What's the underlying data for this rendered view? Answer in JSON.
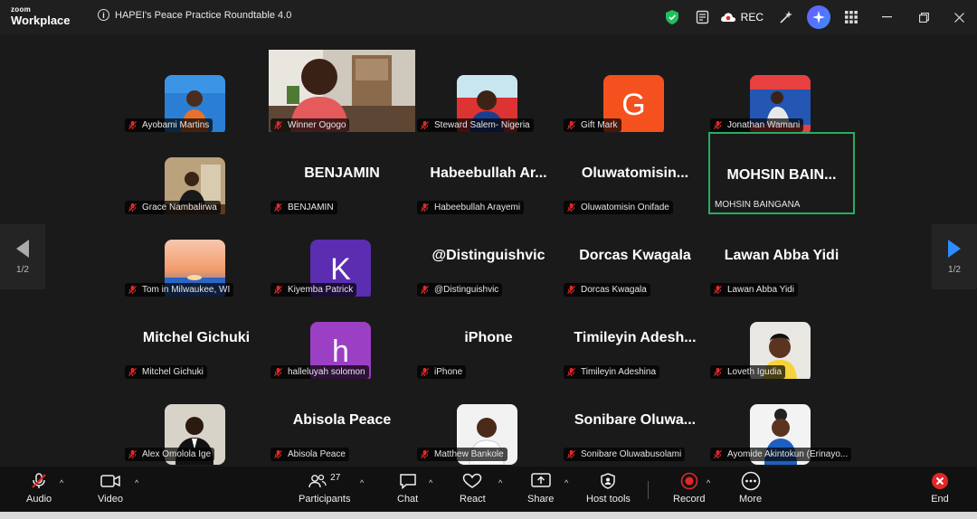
{
  "app": {
    "brand_small": "zoom",
    "brand_big": "Workplace"
  },
  "meeting": {
    "title": "HAPEI's Peace Practice Roundtable 4.0"
  },
  "titlebar": {
    "rec_label": "REC"
  },
  "pager": {
    "left": "1/2",
    "right": "1/2"
  },
  "participants": [
    {
      "name": "Ayobami Martins",
      "display": "photo",
      "photo": "blue"
    },
    {
      "name": "Winner Ogogo",
      "display": "video"
    },
    {
      "name": "Steward Salem- Nigeria",
      "display": "photo",
      "photo": "portrait"
    },
    {
      "name": "Gift Mark",
      "display": "letter",
      "letter": "G",
      "color": "#f4511e"
    },
    {
      "name": "Jonathan Wamani",
      "display": "photo",
      "photo": "stage"
    },
    {
      "name": "Grace Nambalirwa",
      "display": "photo",
      "photo": "office"
    },
    {
      "name": "BENJAMIN",
      "display": "text",
      "big": "BENJAMIN"
    },
    {
      "name": "Habeebullah Arayemi",
      "display": "text",
      "big": "Habeebullah Ar..."
    },
    {
      "name": "Oluwatomisin Onifade",
      "display": "text",
      "big": "Oluwatomisin..."
    },
    {
      "name": "MOHSIN BAINGANA",
      "display": "text",
      "big": "MOHSIN BAIN...",
      "active": true
    },
    {
      "name": "Tom in Milwaukee, WI",
      "display": "photo",
      "photo": "sunset"
    },
    {
      "name": "Kiyemba Patrick",
      "display": "letter",
      "letter": "K",
      "color": "#5b2db0"
    },
    {
      "name": "@Distinguishvic",
      "display": "text",
      "big": "@Distinguishvic"
    },
    {
      "name": "Dorcas Kwagala",
      "display": "text",
      "big": "Dorcas Kwagala"
    },
    {
      "name": "Lawan Abba Yidi",
      "display": "text",
      "big": "Lawan Abba Yidi"
    },
    {
      "name": "Mitchel Gichuki",
      "display": "text",
      "big": "Mitchel Gichuki"
    },
    {
      "name": "halleluyah solomon",
      "display": "letter",
      "letter": "h",
      "color": "#9b3fc4"
    },
    {
      "name": "iPhone",
      "display": "text",
      "big": "iPhone"
    },
    {
      "name": "Timileyin Adeshina",
      "display": "text",
      "big": "Timileyin Adesh..."
    },
    {
      "name": "Loveth Igudia",
      "display": "photo",
      "photo": "woman"
    },
    {
      "name": "Alex Omolola Ige",
      "display": "photo",
      "photo": "suit"
    },
    {
      "name": "Abisola Peace",
      "display": "text",
      "big": "Abisola Peace"
    },
    {
      "name": "Matthew Bankole",
      "display": "photo",
      "photo": "man-white"
    },
    {
      "name": "Sonibare Oluwabusolami",
      "display": "text",
      "big": "Sonibare Oluwa..."
    },
    {
      "name": "Ayomide Akintokun (Erinayo...",
      "display": "photo",
      "photo": "woman2"
    }
  ],
  "toolbar": {
    "audio": "Audio",
    "video": "Video",
    "participants": "Participants",
    "participants_count": "27",
    "chat": "Chat",
    "react": "React",
    "share": "Share",
    "host_tools": "Host tools",
    "record": "Record",
    "more": "More",
    "end": "End"
  },
  "colors": {
    "active_border": "#27ae60",
    "end_red": "#e02828",
    "pager_arrow": "#2d8cff"
  }
}
